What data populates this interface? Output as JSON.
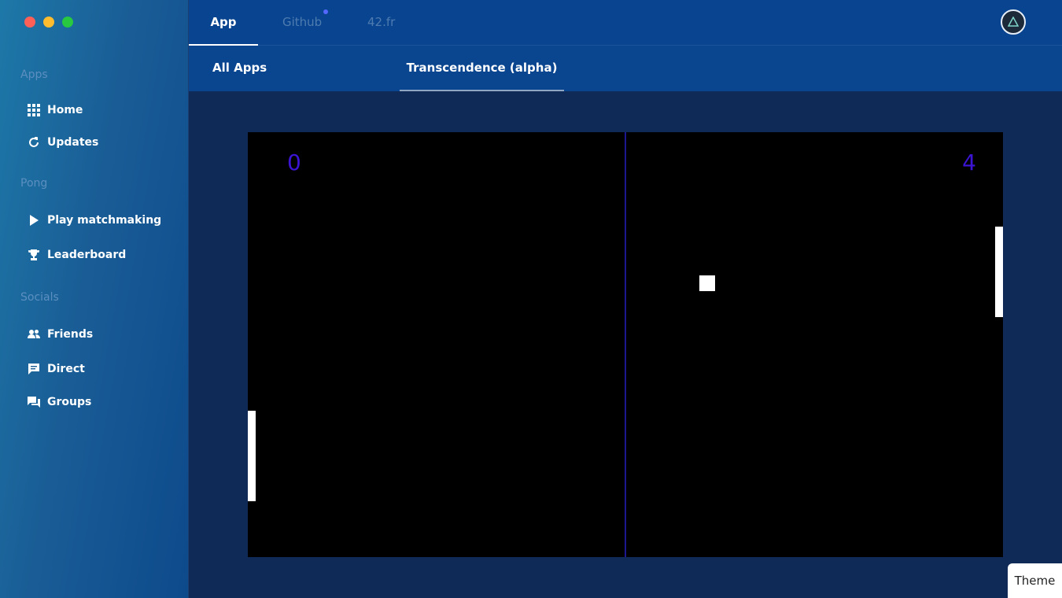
{
  "top_tabs": [
    {
      "label": "App",
      "active": true
    },
    {
      "label": "Github",
      "active": false,
      "notification": true
    },
    {
      "label": "42.fr",
      "active": false
    }
  ],
  "sub_tabs": [
    {
      "label": "All Apps",
      "active": false
    },
    {
      "label": "Transcendence (alpha)",
      "active": true
    }
  ],
  "sidebar": {
    "sections": [
      {
        "title": "Apps",
        "items": [
          {
            "label": "Home",
            "icon": "grid-icon"
          },
          {
            "label": "Updates",
            "icon": "refresh-icon"
          }
        ]
      },
      {
        "title": "Pong",
        "items": [
          {
            "label": "Play matchmaking",
            "icon": "play-icon"
          },
          {
            "label": "Leaderboard",
            "icon": "trophy-icon"
          }
        ]
      },
      {
        "title": "Socials",
        "items": [
          {
            "label": "Friends",
            "icon": "friends-icon"
          },
          {
            "label": "Direct",
            "icon": "chat-icon"
          },
          {
            "label": "Groups",
            "icon": "groups-icon"
          }
        ]
      }
    ]
  },
  "game": {
    "left_score": "0",
    "right_score": "4",
    "colors": {
      "score": "#3b14d4",
      "net": "#1c1690",
      "court": "#000000"
    }
  },
  "theme_button": "Theme",
  "colors": {
    "sidebar": "#1a5d96",
    "topbar": "#08448f",
    "content": "#0f2a56",
    "notification": "#5468ff"
  }
}
